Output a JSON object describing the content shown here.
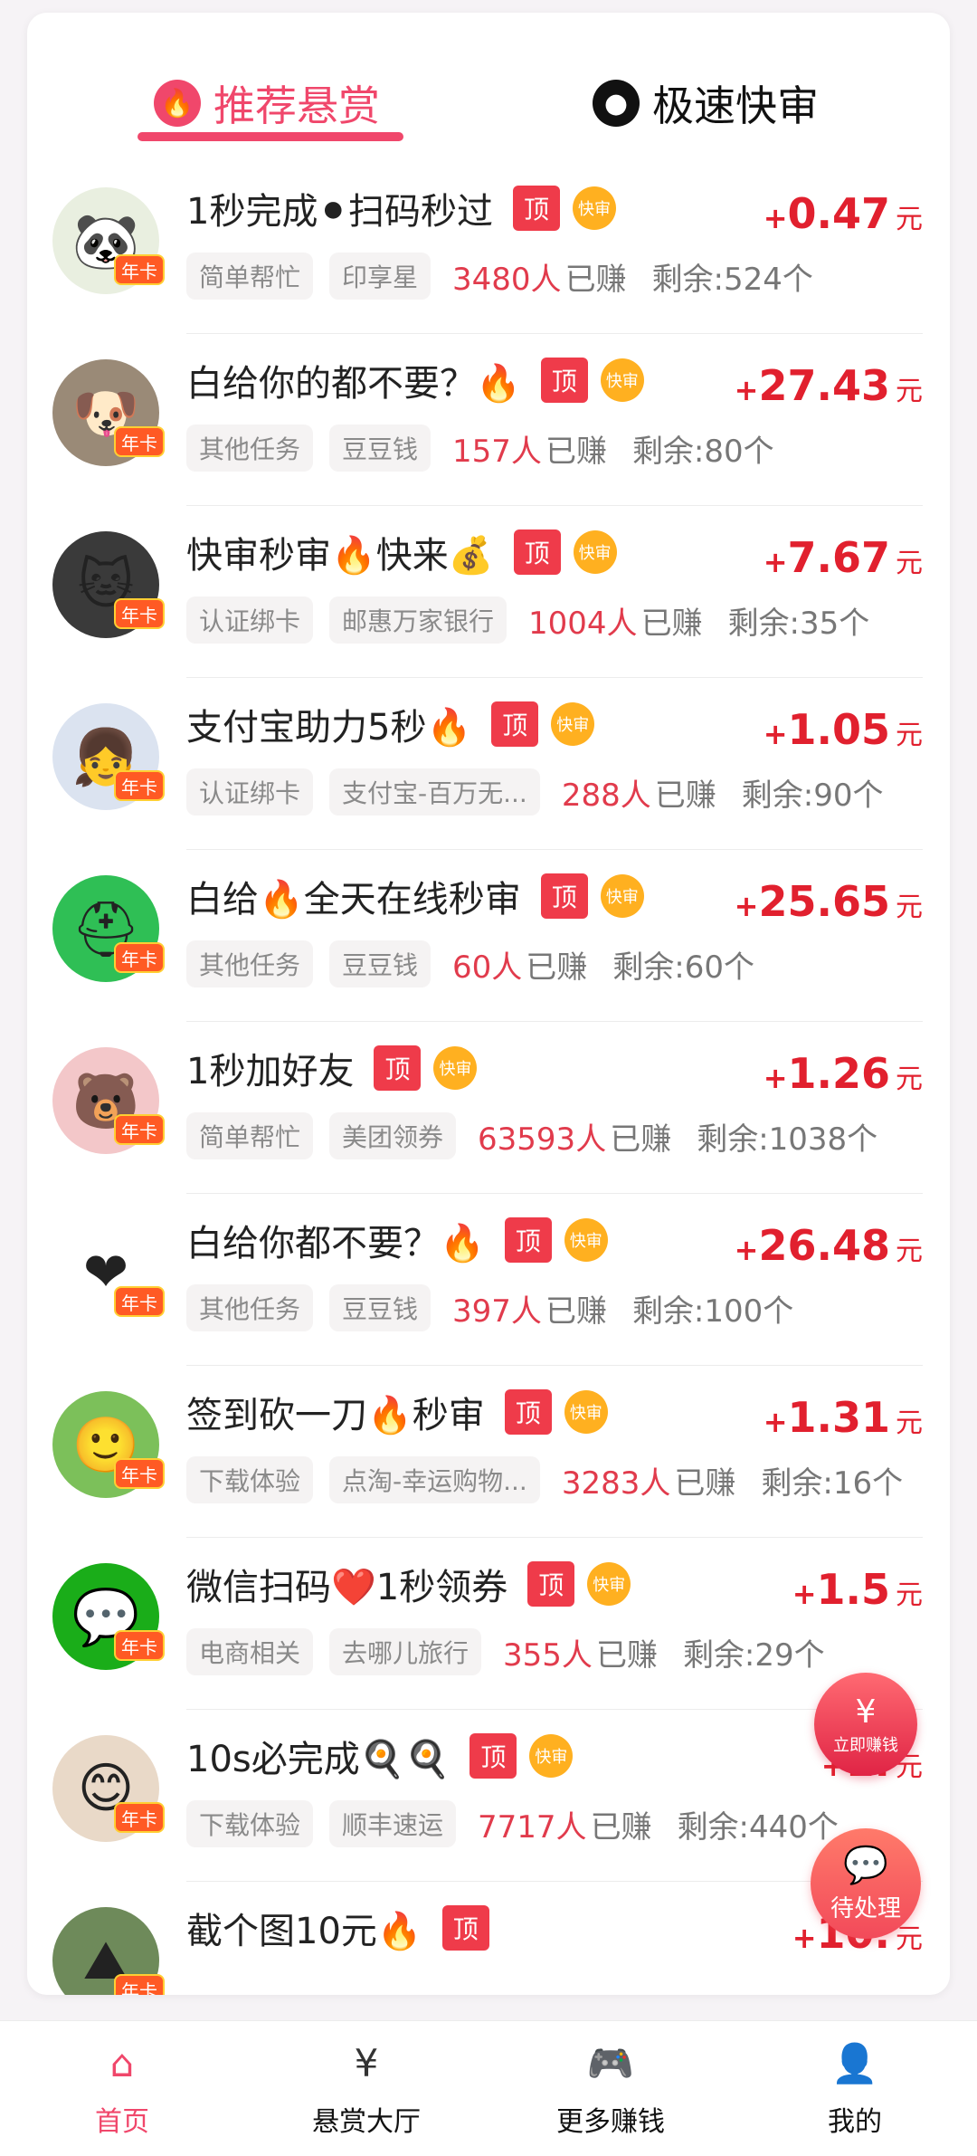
{
  "tabs": {
    "recommend": "推荐悬赏",
    "fast": "极速快审"
  },
  "colors": {
    "accent": "#f0476b",
    "reward": "#e1202e",
    "top_tag": "#ef3b4a",
    "fast_tag": "#ffb020"
  },
  "tags": {
    "top": "顶",
    "fast": "快审",
    "year": "年卡"
  },
  "items": [
    {
      "title": "1秒完成⚫扫码秒过",
      "cat1": "简单帮忙",
      "cat2": "印享星",
      "earned": "3480人",
      "earned_suffix": "已赚",
      "remain": "剩余:524个",
      "plus": "+",
      "amount": "0.47",
      "unit": "元",
      "avatar": "panda-icon"
    },
    {
      "title": "白给你的都不要？🔥",
      "cat1": "其他任务",
      "cat2": "豆豆钱",
      "earned": "157人",
      "earned_suffix": "已赚",
      "remain": "剩余:80个",
      "plus": "+",
      "amount": "27.43",
      "unit": "元",
      "avatar": "husky-icon"
    },
    {
      "title": "快审秒审🔥快来💰",
      "cat1": "认证绑卡",
      "cat2": "邮惠万家银行",
      "earned": "1004人",
      "earned_suffix": "已赚",
      "remain": "剩余:35个",
      "plus": "+",
      "amount": "7.67",
      "unit": "元",
      "avatar": "cat-icon"
    },
    {
      "title": "支付宝助力5秒🔥",
      "cat1": "认证绑卡",
      "cat2": "支付宝-百万无...",
      "earned": "288人",
      "earned_suffix": "已赚",
      "remain": "剩余:90个",
      "plus": "+",
      "amount": "1.05",
      "unit": "元",
      "avatar": "girl-icon"
    },
    {
      "title": "白给🔥全天在线秒审",
      "cat1": "其他任务",
      "cat2": "豆豆钱",
      "earned": "60人",
      "earned_suffix": "已赚",
      "remain": "剩余:60个",
      "plus": "+",
      "amount": "25.65",
      "unit": "元",
      "avatar": "green-helmet-icon"
    },
    {
      "title": "1秒加好友",
      "cat1": "简单帮忙",
      "cat2": "美团领券",
      "earned": "63593人",
      "earned_suffix": "已赚",
      "remain": "剩余:1038个",
      "plus": "+",
      "amount": "1.26",
      "unit": "元",
      "avatar": "bear-icon"
    },
    {
      "title": "白给你都不要？🔥",
      "cat1": "其他任务",
      "cat2": "豆豆钱",
      "earned": "397人",
      "earned_suffix": "已赚",
      "remain": "剩余:100个",
      "plus": "+",
      "amount": "26.48",
      "unit": "元",
      "avatar": "heart-icon"
    },
    {
      "title": "签到砍一刀🔥秒审",
      "cat1": "下载体验",
      "cat2": "点淘-幸运购物...",
      "earned": "3283人",
      "earned_suffix": "已赚",
      "remain": "剩余:16个",
      "plus": "+",
      "amount": "1.31",
      "unit": "元",
      "avatar": "smile-icon"
    },
    {
      "title": "微信扫码❤️1秒领券",
      "cat1": "电商相关",
      "cat2": "去哪儿旅行",
      "earned": "355人",
      "earned_suffix": "已赚",
      "remain": "剩余:29个",
      "plus": "+",
      "amount": "1.5",
      "unit": "元",
      "avatar": "wechat-icon"
    },
    {
      "title": "10s必完成🍳🍳",
      "cat1": "下载体验",
      "cat2": "顺丰速运",
      "earned": "7717人",
      "earned_suffix": "已赚",
      "remain": "剩余:440个",
      "plus": "+",
      "amount": "1.",
      "unit": "元",
      "avatar": "kid-icon"
    },
    {
      "title": "截个图10元🔥",
      "cat1": "",
      "cat2": "",
      "earned": "",
      "earned_suffix": "",
      "remain": "",
      "plus": "+",
      "amount": "10.",
      "unit": "元",
      "avatar": "landscape-icon"
    }
  ],
  "floating": {
    "earn_label": "立即赚钱",
    "earn_icon": "yen-icon",
    "pending_label": "待处理",
    "pending_icon": "chat-icon"
  },
  "nav": [
    {
      "label": "首页",
      "icon": "home-icon"
    },
    {
      "label": "悬赏大厅",
      "icon": "yen-doc-icon"
    },
    {
      "label": "更多赚钱",
      "icon": "gamepad-icon"
    },
    {
      "label": "我的",
      "icon": "user-icon"
    }
  ]
}
